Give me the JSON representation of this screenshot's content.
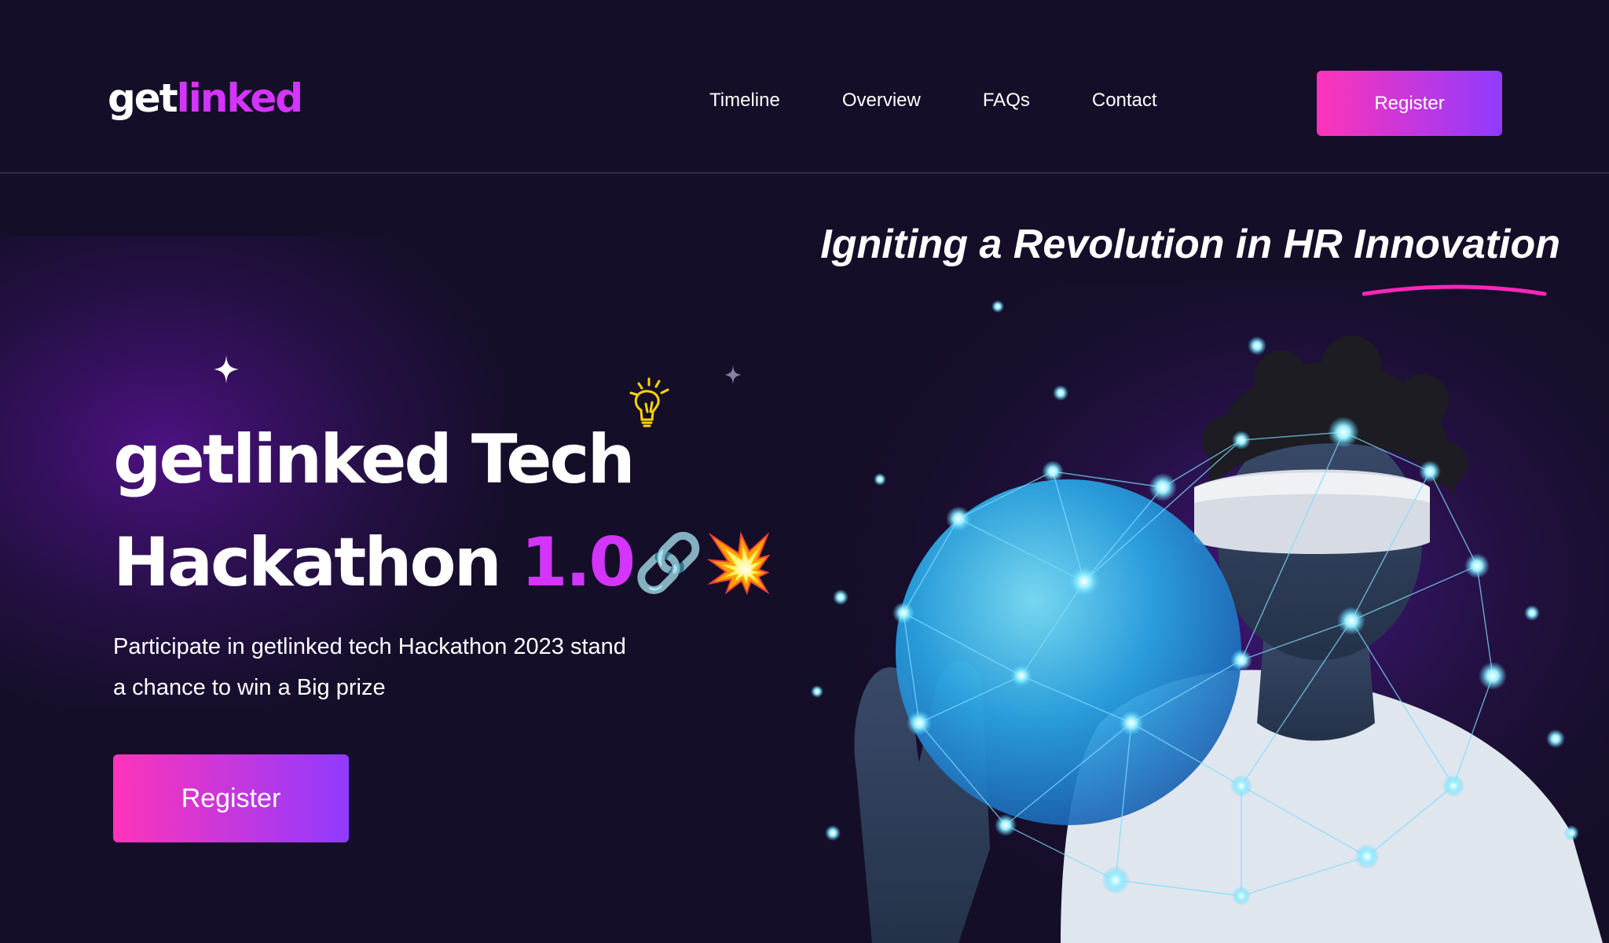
{
  "header": {
    "logo_part_a": "get",
    "logo_part_b": "linked",
    "nav": [
      {
        "label": "Timeline"
      },
      {
        "label": "Overview"
      },
      {
        "label": "FAQs"
      },
      {
        "label": "Contact"
      }
    ],
    "register_label": "Register"
  },
  "hero": {
    "tagline": "Igniting a Revolution in HR Innovation",
    "headline_line1": "getlinked Tech",
    "headline_line2_prefix": "Hackathon",
    "headline_line2_accent": "1.0",
    "headline_emojis": [
      "🔗",
      "💥"
    ],
    "description": "Participate in getlinked tech Hackathon 2023 stand a chance to win a Big prize",
    "register_label": "Register",
    "decorations": [
      "sparkle-icon",
      "lightbulb-icon",
      "chain-link-icon",
      "collision-icon"
    ]
  },
  "colors": {
    "background": "#150e28",
    "accent_purple": "#d434fe",
    "gradient_start": "#fe34b9",
    "gradient_end": "#903aff",
    "underline": "#ff26b9",
    "network_blue": "#4fd2ff"
  }
}
